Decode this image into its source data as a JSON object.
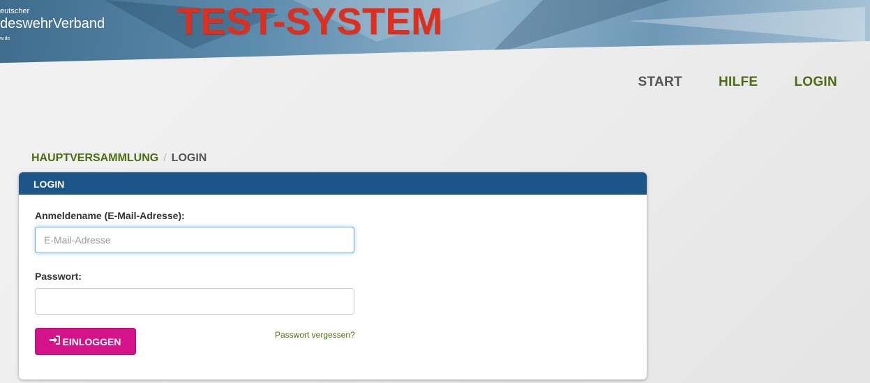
{
  "header": {
    "brand_top": "eutscher",
    "brand_main": "deswehrVerband",
    "brand_url": "w.de",
    "system_label": "TEST-SYSTEM"
  },
  "nav": {
    "items": [
      {
        "label": "START"
      },
      {
        "label": "HILFE"
      },
      {
        "label": "LOGIN"
      }
    ]
  },
  "breadcrumb": {
    "parent": "HAUPTVERSAMMLUNG",
    "separator": "/",
    "current": "LOGIN"
  },
  "login_panel": {
    "title": "LOGIN",
    "email_label": "Anmeldename (E-Mail-Adresse):",
    "email_placeholder": "E-Mail-Adresse",
    "email_value": "",
    "password_label": "Passwort:",
    "password_value": "",
    "submit_label": "EINLOGGEN",
    "submit_icon": "sign-in-icon",
    "forgot_link": "Passwort vergessen?"
  },
  "colors": {
    "accent_green": "#4e6b12",
    "panel_header": "#1c5588",
    "button_magenta": "#d4138a",
    "test_system_red": "#dd2e1e"
  }
}
